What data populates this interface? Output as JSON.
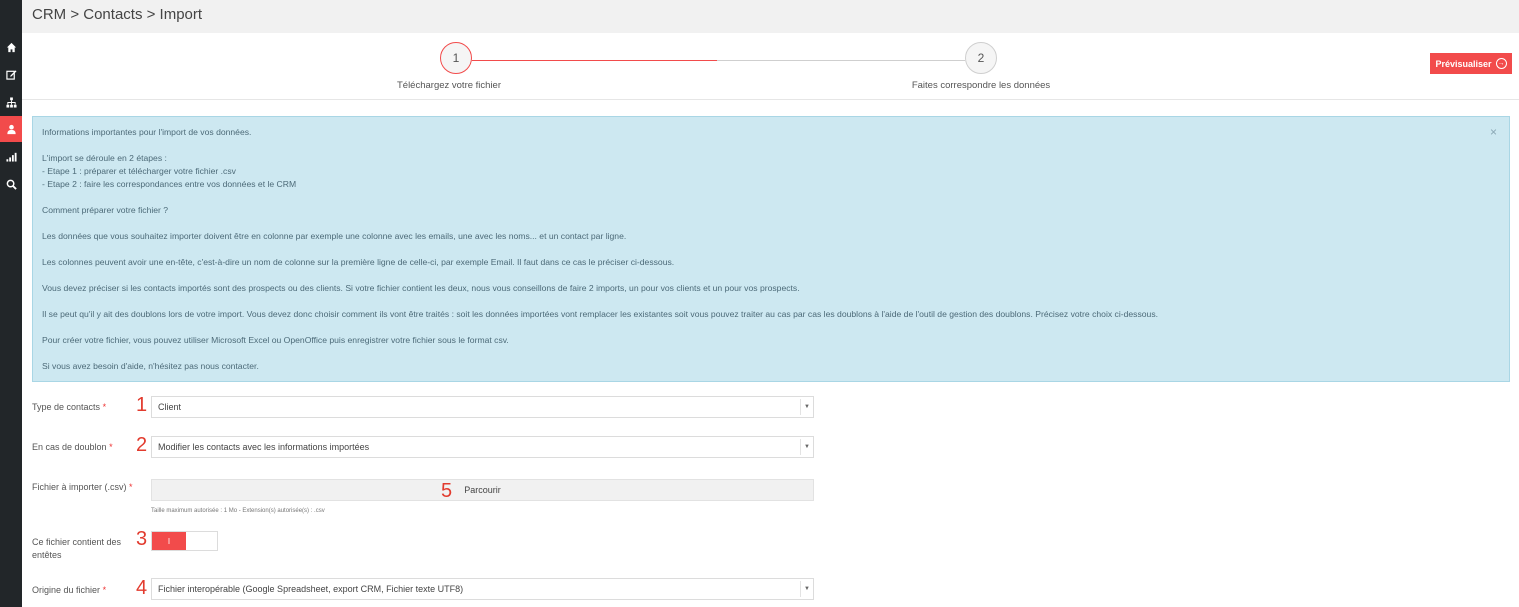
{
  "breadcrumb": "CRM > Contacts > Import",
  "sidebar": {
    "items": [
      {
        "icon": "home-icon"
      },
      {
        "icon": "edit-icon"
      },
      {
        "icon": "sitemap-icon"
      },
      {
        "icon": "user-icon",
        "active": true
      },
      {
        "icon": "signal-icon"
      },
      {
        "icon": "search-icon"
      }
    ]
  },
  "stepper": {
    "steps": [
      {
        "number": "1",
        "label": "Téléchargez votre fichier",
        "active": true
      },
      {
        "number": "2",
        "label": "Faites correspondre les données",
        "active": false
      }
    ]
  },
  "preview_button": {
    "label": "Prévisualiser",
    "icon": "arrow-circle-right-icon"
  },
  "info": {
    "close": "×",
    "lines": [
      "Informations importantes pour l'import de vos données.",
      "L'import se déroule en 2 étapes :",
      "- Etape 1 : préparer et télécharger votre fichier .csv",
      "- Etape 2 : faire les correspondances entre vos données et le CRM",
      "Comment préparer votre fichier ?",
      "Les données que vous souhaitez importer doivent être en colonne par exemple une colonne avec les emails, une avec les noms... et un contact par ligne.",
      "Les colonnes peuvent avoir une en-tête, c'est-à-dire un nom de colonne sur la première ligne de celle-ci, par exemple Email. Il faut dans ce cas le préciser ci-dessous.",
      "Vous devez préciser si les contacts importés sont des prospects ou des clients. Si votre fichier contient les deux, nous vous conseillons de faire 2 imports, un pour vos clients et un pour vos prospects.",
      "Il se peut qu'il y ait des doublons lors de votre import. Vous devez donc choisir comment ils vont être traités : soit les données importées vont remplacer les existantes soit vous pouvez traiter au cas par cas les doublons à l'aide de l'outil de gestion des doublons. Précisez votre choix ci-dessous.",
      "Pour créer votre fichier, vous pouvez utiliser Microsoft Excel ou OpenOffice puis enregistrer votre fichier sous le format csv.",
      "Si vous avez besoin d'aide, n'hésitez pas nous contacter."
    ]
  },
  "form": {
    "required_mark": "*",
    "type_contacts": {
      "label": "Type de contacts",
      "value": "Client",
      "annotation": "1"
    },
    "doublon": {
      "label": "En cas de doublon",
      "value": "Modifier les contacts avec les informations importées",
      "annotation": "2"
    },
    "fichier": {
      "label": "Fichier à importer (.csv)",
      "button": "Parcourir",
      "hint": "Taille maximum autorisée : 1 Mo - Extension(s) autorisée(s) : .csv",
      "annotation": "5"
    },
    "entetes": {
      "label_line1": "Ce fichier contient des",
      "label_line2": "entêtes",
      "toggle_on": "I",
      "checked": true,
      "annotation": "3"
    },
    "origine": {
      "label": "Origine du fichier",
      "value": "Fichier interopérable (Google Spreadsheet, export CRM, Fichier texte UTF8)",
      "annotation": "4"
    }
  },
  "colors": {
    "accent": "#f24b4b",
    "sidebar": "#222629",
    "info_bg": "#cde8f1",
    "annotation": "#e23b2e"
  }
}
